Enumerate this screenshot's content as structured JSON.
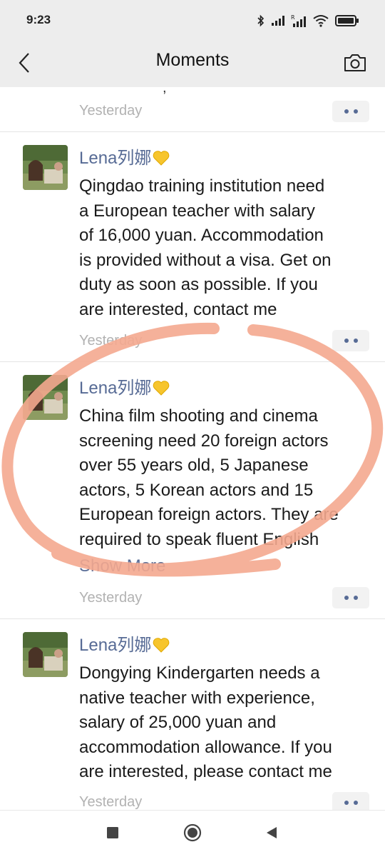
{
  "status_bar": {
    "time": "9:23",
    "icons": [
      "bluetooth-icon",
      "signal-icon",
      "signal-roaming-icon",
      "wifi-icon",
      "battery-icon"
    ]
  },
  "nav": {
    "title": "Moments",
    "back_icon": "chevron-left-icon",
    "camera_icon": "camera-icon"
  },
  "feed": {
    "cut_post": {
      "fragment": ",",
      "time": "Yesterday"
    },
    "posts": [
      {
        "nickname": "Lena列娜",
        "lines": [
          "Qingdao training institution need",
          "a European teacher with  salary",
          "of 16,000 yuan. Accommodation",
          "is provided without a visa. Get on",
          "duty as soon as possible. If you",
          "are interested, contact me"
        ],
        "time": "Yesterday"
      },
      {
        "nickname": "Lena列娜",
        "lines": [
          "China film shooting and cinema",
          "screening need 20 foreign actors",
          "over 55 years old, 5 Japanese",
          "actors, 5 Korean actors and 15",
          "European foreign actors. They are",
          "required to speak fluent English"
        ],
        "show_more": "Show More",
        "time": "Yesterday"
      },
      {
        "nickname": "Lena列娜",
        "lines": [
          "Dongying Kindergarten needs a",
          "native teacher with experience,",
          "salary of 25,000 yuan and",
          "accommodation allowance. If you",
          "are interested, please contact me"
        ],
        "time": "Yesterday"
      }
    ]
  },
  "bottom_nav": [
    "recents-square-icon",
    "home-circle-icon",
    "back-triangle-icon"
  ],
  "colors": {
    "link": "#576b95",
    "time": "#b2b2b2",
    "header_bg": "#ededed",
    "circle_annotation": "#f4a98f"
  }
}
